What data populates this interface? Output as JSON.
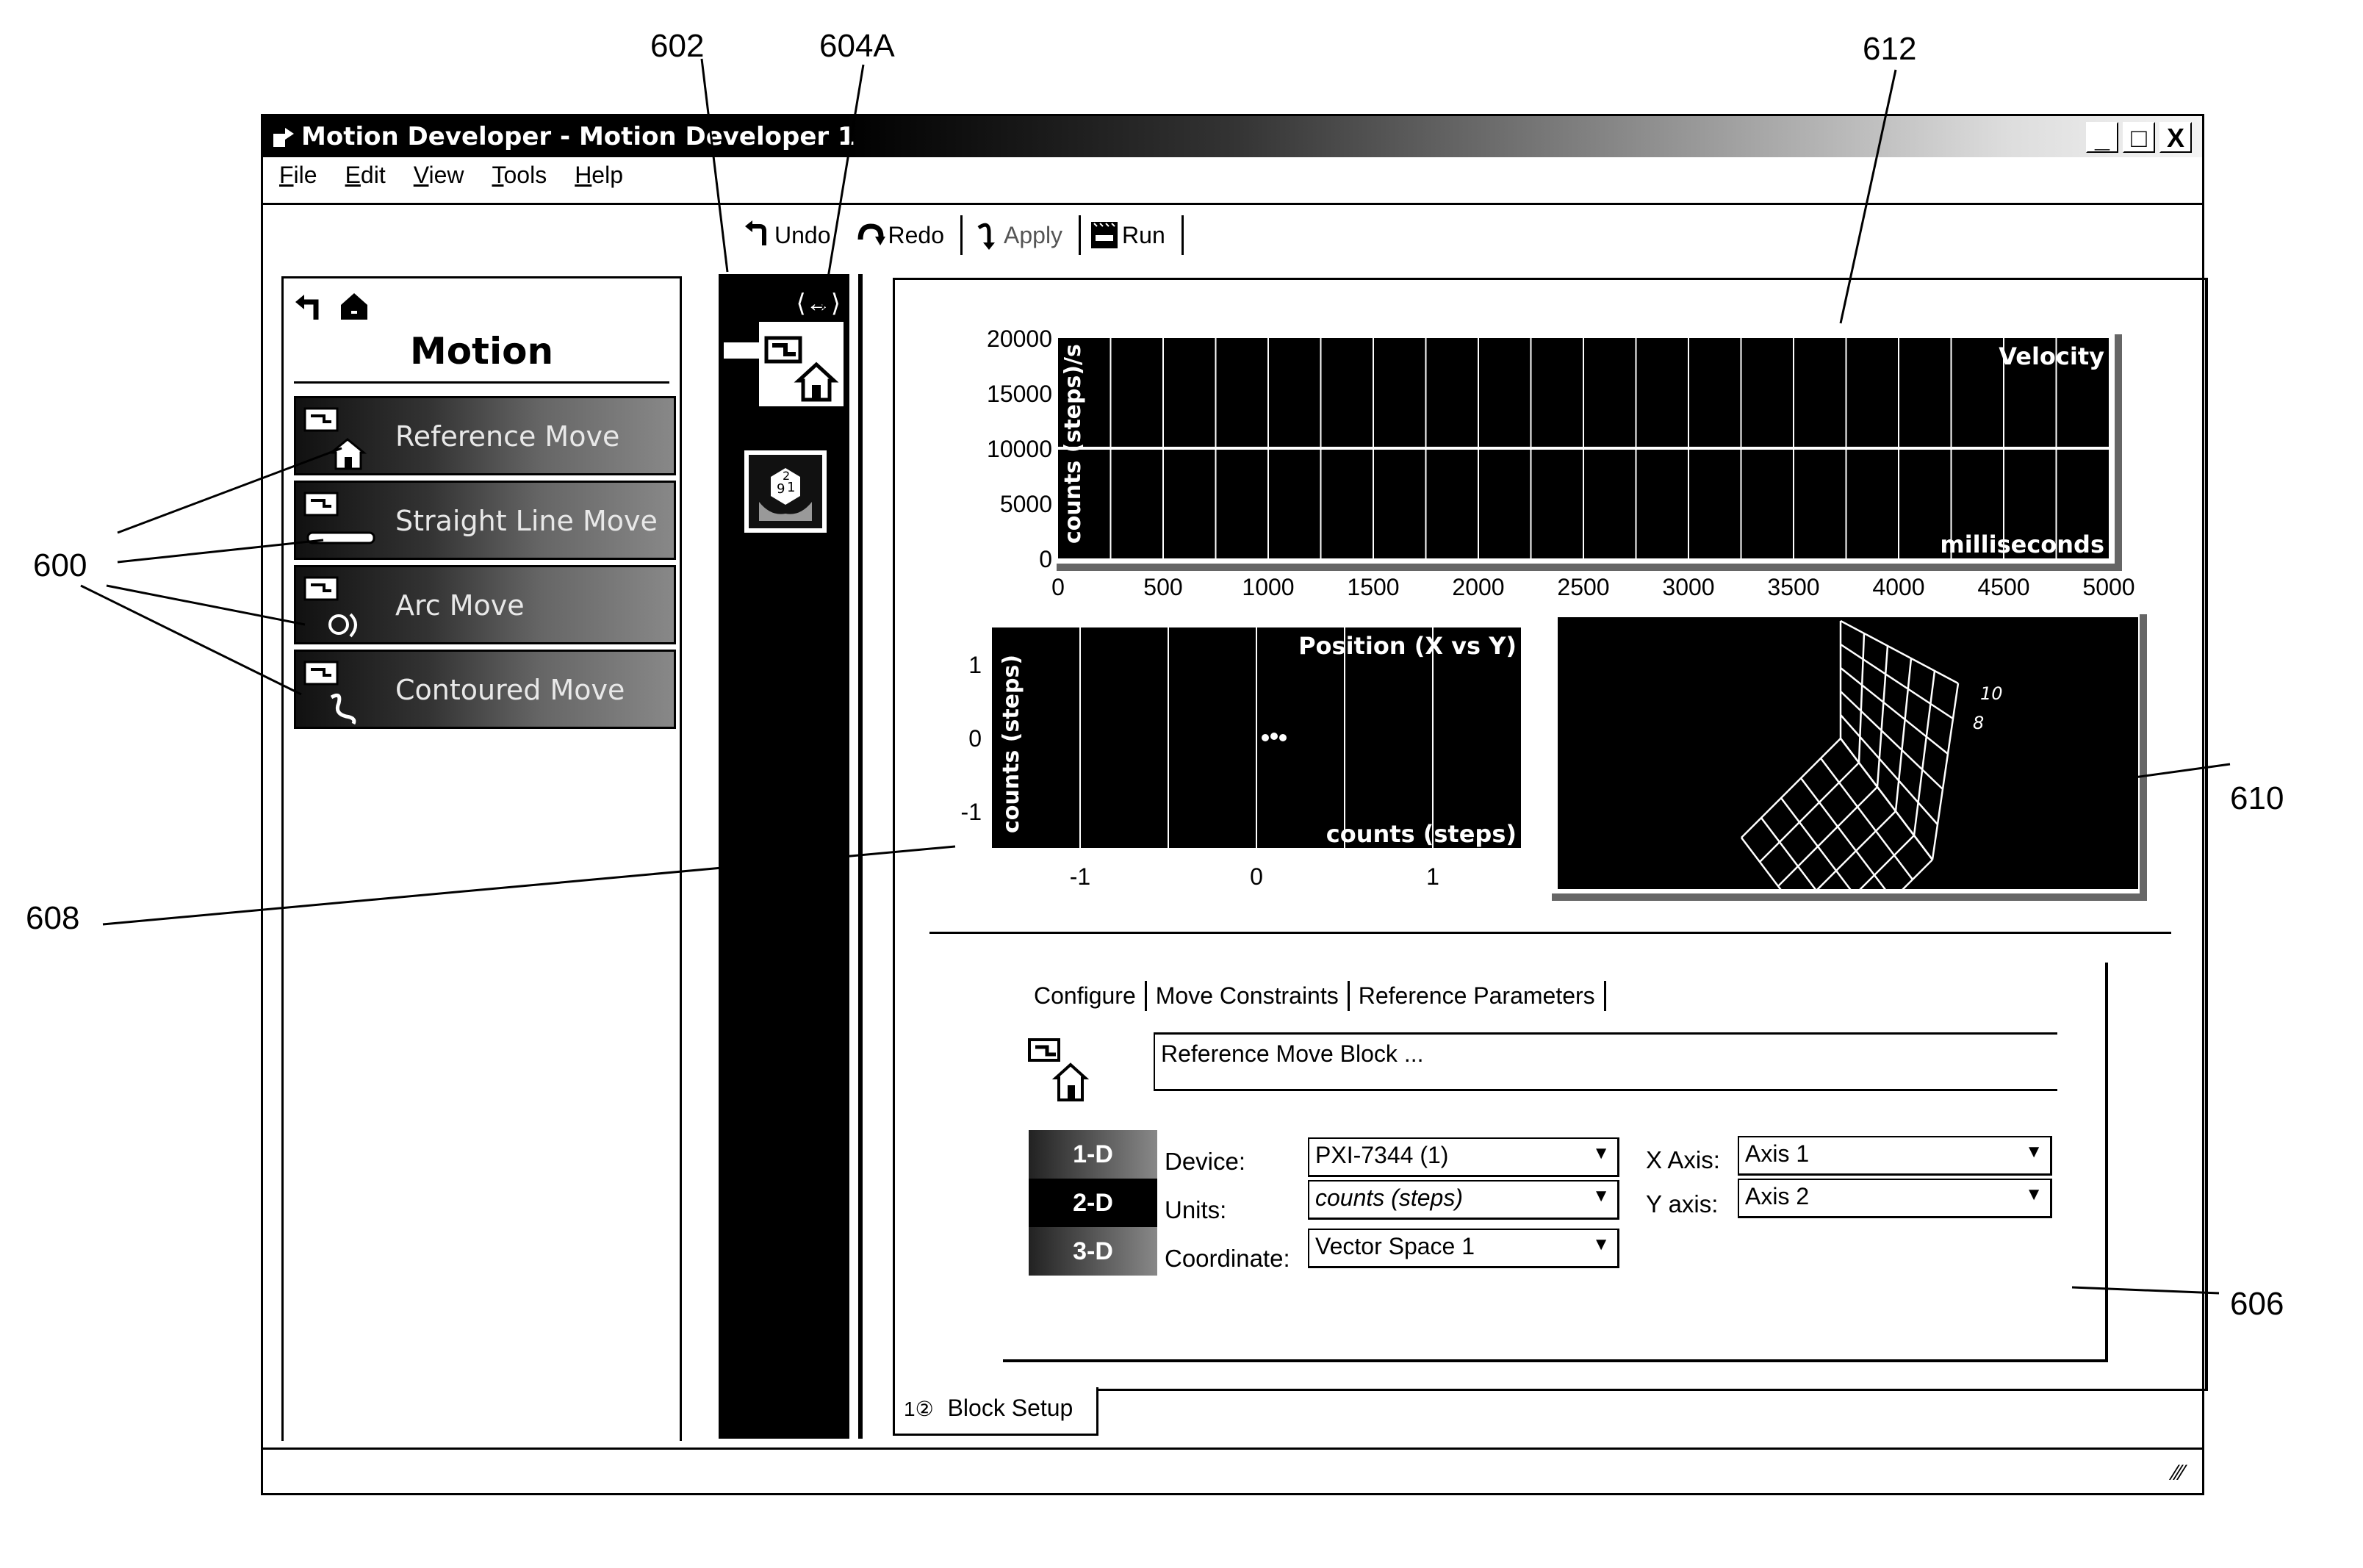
{
  "callouts": {
    "c600": "600",
    "c602": "602",
    "c604a": "604A",
    "c606": "606",
    "c608": "608",
    "c610": "610",
    "c612": "612"
  },
  "window": {
    "title": "Motion Developer - Motion Developer 1",
    "controls": {
      "minimize": "_",
      "maximize": "□",
      "close": "X"
    }
  },
  "menu": {
    "items": [
      "File",
      "Edit",
      "View",
      "Tools",
      "Help"
    ]
  },
  "toolbar": {
    "undo": "Undo",
    "redo": "Redo",
    "apply": "Apply",
    "run": "Run"
  },
  "palette": {
    "heading": "Motion",
    "items": [
      {
        "label": "Reference Move",
        "icon": "reference-move-icon"
      },
      {
        "label": "Straight Line Move",
        "icon": "straight-line-move-icon"
      },
      {
        "label": "Arc Move",
        "icon": "arc-move-icon"
      },
      {
        "label": "Contoured Move",
        "icon": "contoured-move-icon"
      }
    ]
  },
  "strip": {
    "expand_glyph": "⟨↔⟩",
    "blocks": [
      {
        "name": "reference-move-block",
        "active": true
      },
      {
        "name": "dice-block",
        "active": false
      }
    ]
  },
  "chart_data": [
    {
      "type": "line",
      "title": "Velocity",
      "xlabel": "milliseconds",
      "ylabel": "counts (steps)/s",
      "xlim": [
        0,
        5000
      ],
      "ylim": [
        0,
        20000
      ],
      "xticks": [
        0,
        500,
        1000,
        1500,
        2000,
        2500,
        3000,
        3500,
        4000,
        4500,
        5000
      ],
      "yticks": [
        0,
        5000,
        10000,
        15000,
        20000
      ],
      "x_gridlines_every": 250,
      "grid": true,
      "series": [
        {
          "name": "velocity",
          "x": [
            0,
            5000
          ],
          "y": [
            10000,
            10000
          ]
        }
      ]
    },
    {
      "type": "scatter",
      "title": "Position (X vs Y)",
      "xlabel": "counts (steps)",
      "ylabel": "counts (steps)",
      "xlim": [
        -1.5,
        1.5
      ],
      "ylim": [
        -1.5,
        1.5
      ],
      "xticks": [
        -1,
        0,
        1
      ],
      "yticks": [
        -1,
        0,
        1
      ],
      "x_gridlines": [
        -1,
        -0.5,
        0,
        0.5,
        1
      ],
      "grid": true,
      "series": [
        {
          "name": "position",
          "x": [
            0.05,
            0.1,
            0.15
          ],
          "y": [
            0,
            0.02,
            0
          ]
        }
      ]
    },
    {
      "type": "surface3d",
      "title": "",
      "axis_tick_labels_visible": [
        "10",
        "8"
      ],
      "grid_divisions": 5
    }
  ],
  "config": {
    "tabs": [
      "Configure",
      "Move Constraints",
      "Reference Parameters"
    ],
    "active_tab": "Configure",
    "description": "Reference Move Block ...",
    "dimension_buttons": [
      "1-D",
      "2-D",
      "3-D"
    ],
    "selected_dimension": "2-D",
    "fields": {
      "device": {
        "label": "Device:",
        "value": "PXI-7344 (1)"
      },
      "units": {
        "label": "Units:",
        "value": "counts (steps)"
      },
      "coordinate": {
        "label": "Coordinate:",
        "value": "Vector Space 1"
      },
      "x_axis": {
        "label": "X Axis:",
        "value": "Axis 1"
      },
      "y_axis": {
        "label": "Y axis:",
        "value": "Axis 2"
      }
    }
  },
  "bottom_tab": {
    "label": "Block Setup",
    "icon_text": "1②"
  }
}
